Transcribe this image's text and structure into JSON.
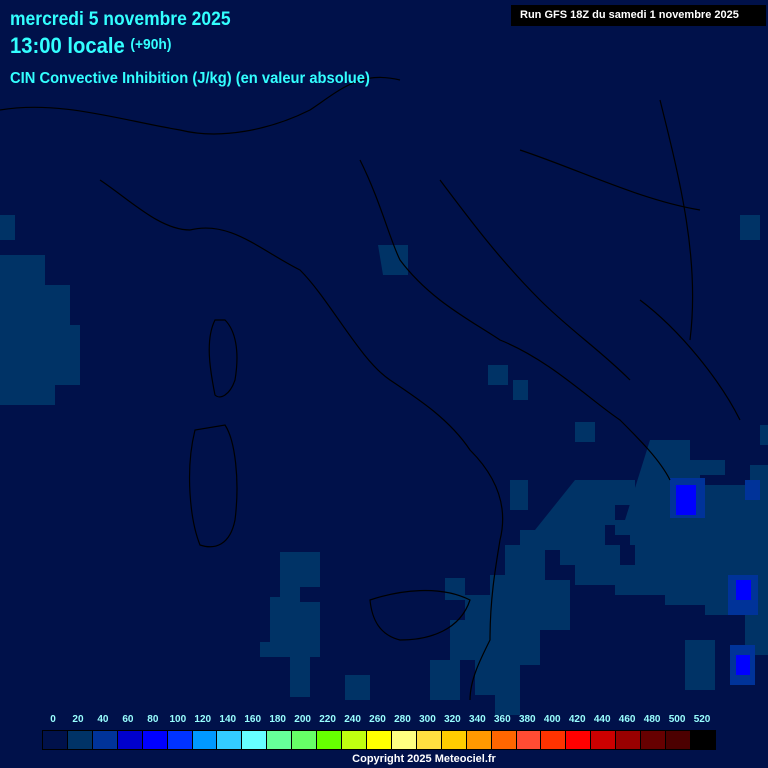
{
  "header": {
    "date": "mercredi 5 novembre 2025",
    "time": "13:00 locale",
    "offset": "(+90h)",
    "parameter": "CIN Convective Inhibition (J/kg) (en valeur absolue)",
    "run": "Run GFS 18Z du samedi 1 novembre 2025"
  },
  "colors": {
    "background": "#00114a",
    "field_low": "#003366",
    "field_mid": "#003399",
    "field_high": "#0000ff",
    "border": "#000000"
  },
  "legend": {
    "labels": [
      "0",
      "20",
      "40",
      "60",
      "80",
      "100",
      "120",
      "140",
      "160",
      "180",
      "200",
      "220",
      "240",
      "260",
      "280",
      "300",
      "320",
      "340",
      "360",
      "380",
      "400",
      "420",
      "440",
      "460",
      "480",
      "500",
      "520"
    ],
    "colors": [
      "#00114a",
      "#003366",
      "#003399",
      "#0000cc",
      "#0000ff",
      "#0033ff",
      "#0099ff",
      "#33ccff",
      "#66ffff",
      "#66ff99",
      "#66ff66",
      "#66ff00",
      "#c0ff10",
      "#ffff00",
      "#ffff80",
      "#ffe040",
      "#ffcc00",
      "#ff9900",
      "#ff6600",
      "#ff4c33",
      "#ff3300",
      "#ff0000",
      "#cc0000",
      "#990000",
      "#660000",
      "#4c0000",
      "#000000"
    ]
  },
  "footer": {
    "copyright": "Copyright 2025 Meteociel.fr"
  }
}
